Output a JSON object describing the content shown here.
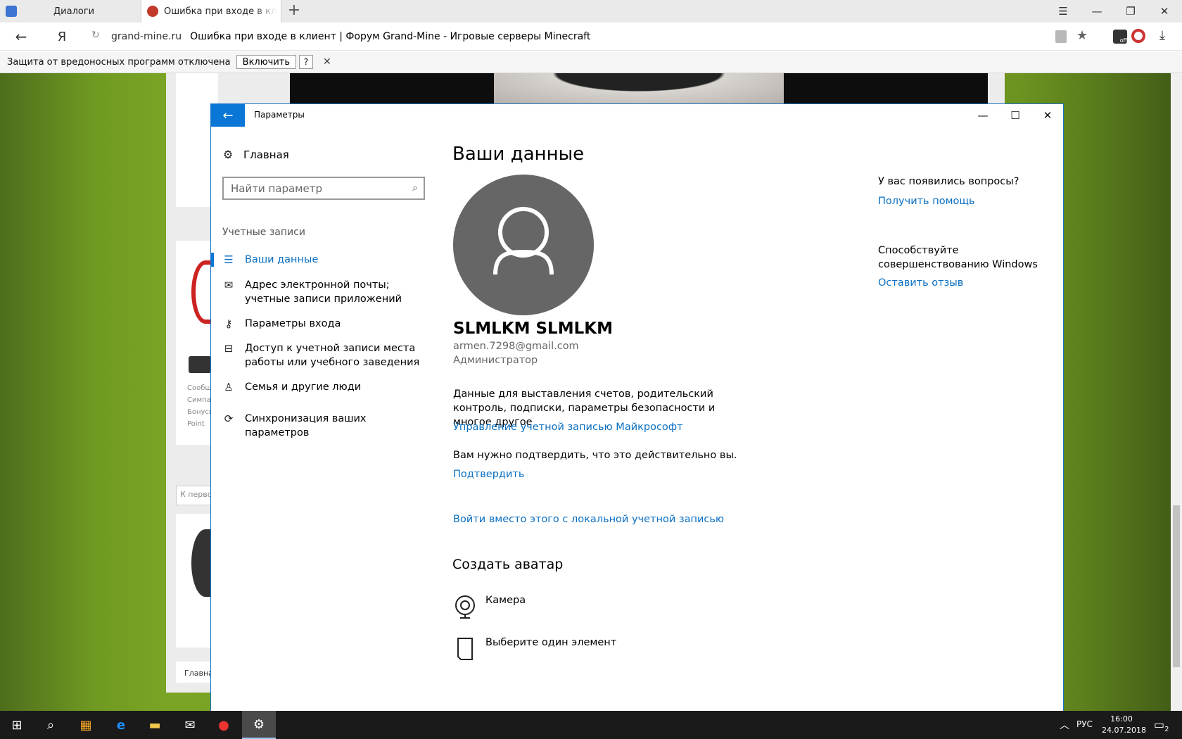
{
  "browser": {
    "tabs": [
      {
        "label": "Диалоги"
      },
      {
        "label": "Ошибка при входе в клиент"
      }
    ],
    "address": {
      "domain": "grand-mine.ru",
      "title": "Ошибка при входе в клиент | Форум Grand-Mine - Игровые серверы Minecraft"
    },
    "yandex_btn": "Я",
    "protect_bar": {
      "text": "Защита от вредоносных программ отключена",
      "enable_label": "Включить",
      "help_label": "?"
    }
  },
  "webpage": {
    "snippets": [
      "Сообщ",
      "Симпат",
      "Бонусы",
      "Point",
      "К первой",
      "Главна"
    ]
  },
  "settings": {
    "window_title": "Параметры",
    "nav": {
      "home_label": "Главная",
      "search_placeholder": "Найти параметр",
      "section": "Учетные записи",
      "items": [
        {
          "label": "Ваши данные"
        },
        {
          "label": "Адрес электронной почты; учетные записи приложений"
        },
        {
          "label": "Параметры входа"
        },
        {
          "label": "Доступ к учетной записи места работы или учебного заведения"
        },
        {
          "label": "Семья и другие люди"
        },
        {
          "label": "Синхронизация ваших параметров"
        }
      ]
    },
    "main": {
      "title": "Ваши данные",
      "user_name": "SLMLKM SLMLKM",
      "email": "armen.7298@gmail.com",
      "role": "Администратор",
      "billing_desc": "Данные для выставления счетов, родительский контроль, подписки, параметры безопасности и многое другое",
      "manage_link": "Управление учетной записью Майкрософт",
      "verify_text": "Вам нужно подтвердить, что это действительно вы.",
      "verify_link": "Подтвердить",
      "local_link": "Войти вместо этого с локальной учетной записью",
      "avatar_title": "Создать аватар",
      "camera_label": "Камера",
      "browse_label": "Выберите один элемент"
    },
    "side": {
      "question": "У вас появились вопросы?",
      "help_link": "Получить помощь",
      "contribute": "Способствуйте совершенствованию Windows",
      "feedback_link": "Оставить отзыв"
    }
  },
  "taskbar": {
    "lang": "РУС",
    "time": "16:00",
    "date": "24.07.2018",
    "notif_count": "2"
  },
  "colors": {
    "accent": "#0a76d6",
    "link": "#0a6fc2",
    "avatar_bg": "#666666"
  }
}
